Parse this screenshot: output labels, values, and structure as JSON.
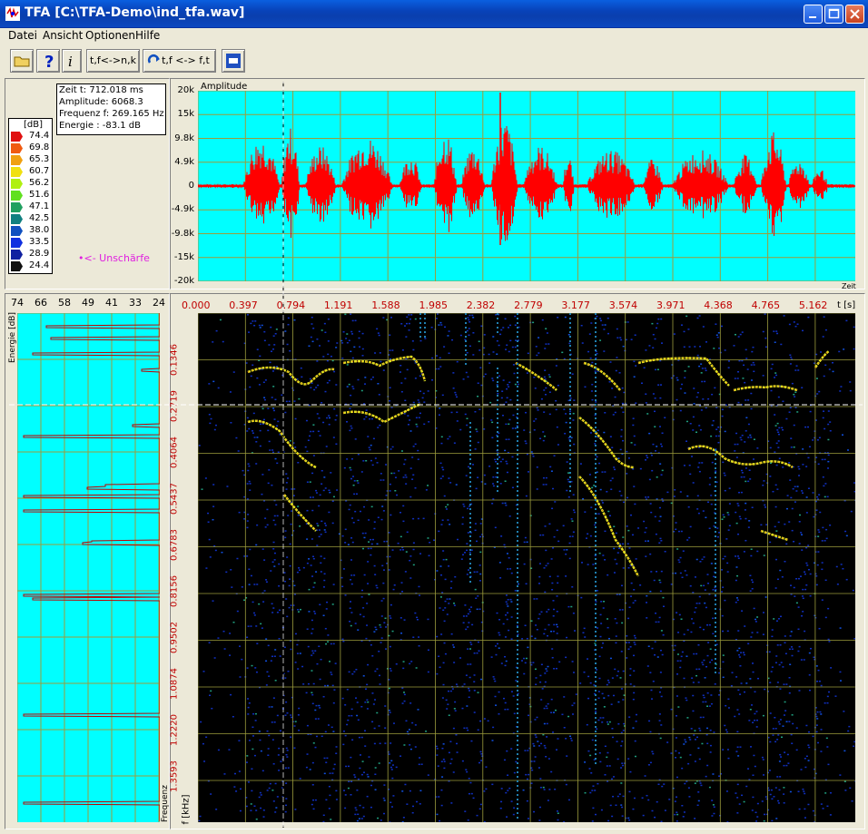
{
  "window": {
    "title": "TFA [C:\\TFA-Demo\\ind_tfa.wav]"
  },
  "menu": [
    {
      "label": "Datei",
      "key": "D"
    },
    {
      "label": "Ansicht",
      "key": "A"
    },
    {
      "label": "Optionen",
      "key": "O"
    },
    {
      "label": "Hilfe",
      "key": "H"
    }
  ],
  "toolbar": {
    "btn_tf_nk": "t,f<->n,k",
    "btn_tf_ft": "t,f <-> f,t",
    "zoom_minus": "-",
    "zoom_plus": "+"
  },
  "cursor_info": {
    "time": "Zeit t: 712.018 ms",
    "amplitude": "Amplitude: 6068.3",
    "frequency": "Frequenz f: 269.165 Hz",
    "energy": "Energie : -83.1 dB"
  },
  "color_legend": {
    "unit": "[dB]",
    "levels": [
      {
        "value": "74.4",
        "color": "#e01010"
      },
      {
        "value": "69.8",
        "color": "#f05a10"
      },
      {
        "value": "65.3",
        "color": "#f0a010"
      },
      {
        "value": "60.7",
        "color": "#f0e010"
      },
      {
        "value": "56.2",
        "color": "#b0f010"
      },
      {
        "value": "51.6",
        "color": "#60e020"
      },
      {
        "value": "47.1",
        "color": "#20a060"
      },
      {
        "value": "42.5",
        "color": "#108080"
      },
      {
        "value": "38.0",
        "color": "#1050c0"
      },
      {
        "value": "33.5",
        "color": "#1030e0"
      },
      {
        "value": "28.9",
        "color": "#1020a0"
      },
      {
        "value": "24.4",
        "color": "#101010"
      }
    ]
  },
  "unschaerfe_label": "•<- Unschärfe",
  "waveform": {
    "title": "Amplitude",
    "xlabel": "Zeit",
    "y_ticks": [
      "20k",
      "15k",
      "9.8k",
      "4.9k",
      "0",
      "-4.9k",
      "-9.8k",
      "-15k",
      "-20k"
    ]
  },
  "energy_panel": {
    "ylabel": "Energie [dB]",
    "xlabel": "Frequenz",
    "x_ticks": [
      "74",
      "66",
      "58",
      "49",
      "41",
      "33",
      "24"
    ]
  },
  "spectrogram": {
    "time_unit": "t [s]",
    "freq_unit": "f [kHz]",
    "time_ticks": [
      "0.000",
      "0.397",
      "0.794",
      "1.191",
      "1.588",
      "1.985",
      "2.382",
      "2.779",
      "3.177",
      "3.574",
      "3.971",
      "4.368",
      "4.765",
      "5.162"
    ],
    "freq_ticks": [
      "0.1346",
      "0.2719",
      "0.4064",
      "0.5437",
      "0.6783",
      "0.8156",
      "0.9502",
      "1.0874",
      "1.2220",
      "1.3593"
    ]
  },
  "colors": {
    "panel_bg": "#00ffff",
    "signal": "#ff0000",
    "grid": "#9c9c3c",
    "spectrogram_bg": "#000000"
  }
}
